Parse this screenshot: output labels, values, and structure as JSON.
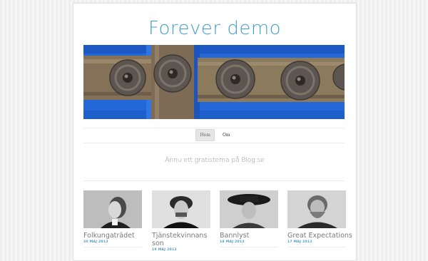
{
  "site": {
    "title": "Forever demo",
    "tagline": "Ännu ett gratistema på Blog.se"
  },
  "nav": {
    "items": [
      {
        "label": "Hem",
        "active": true
      },
      {
        "label": "Om",
        "active": false
      }
    ]
  },
  "header_image": {
    "description_icon": "door-ornament-image",
    "colors": {
      "blue": "#1e64d8",
      "wood": "#8a7656",
      "metal": "#5b5550"
    }
  },
  "posts": [
    {
      "title": "Folkungaträdet",
      "date": "20 MAJ 2012"
    },
    {
      "title": "Tjänstekvinnans son",
      "date": "19 MAJ 2012"
    },
    {
      "title": "Bannlyst",
      "date": "18 MAJ 2012"
    },
    {
      "title": "Great Expectations",
      "date": "17 MAJ 2012"
    }
  ],
  "colors": {
    "accent": "#3f9ed0"
  }
}
